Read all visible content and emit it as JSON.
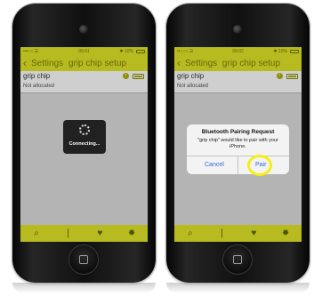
{
  "left_phone": {
    "status": {
      "carrier": "•••○○ ☰",
      "time": "09:01",
      "right": "✱ 10%"
    },
    "nav": {
      "back": "Settings",
      "title": "grip chip setup"
    },
    "device_row": {
      "name": "grip chip",
      "status": "Not allocated"
    },
    "overlay": {
      "text": "Connecting..."
    },
    "tabs": [
      {
        "icon": "search-icon",
        "glyph": "⌕"
      },
      {
        "icon": "pin-icon",
        "glyph": "❘"
      },
      {
        "icon": "heart-icon",
        "glyph": "♥"
      },
      {
        "icon": "gear-icon",
        "glyph": "✹"
      }
    ]
  },
  "right_phone": {
    "status": {
      "carrier": "••○○○ ☰",
      "time": "09:02",
      "right": "✱ 10%"
    },
    "nav": {
      "back": "Settings",
      "title": "grip chip setup"
    },
    "device_row": {
      "name": "grip chip",
      "status": "Not allocated"
    },
    "dialog": {
      "title": "Bluetooth Pairing Request",
      "message": "\"grip chip\" would like to pair with your iPhone.",
      "cancel": "Cancel",
      "pair": "Pair"
    },
    "highlight_color": "#f6ef16",
    "tabs": [
      {
        "icon": "search-icon",
        "glyph": "⌕"
      },
      {
        "icon": "pin-icon",
        "glyph": "❘"
      },
      {
        "icon": "heart-icon",
        "glyph": "♥"
      },
      {
        "icon": "gear-icon",
        "glyph": "✹"
      }
    ]
  },
  "colors": {
    "accent": "#b7bb1f",
    "screen_dim": "#b4b4b4",
    "link": "#2c6ad9"
  }
}
